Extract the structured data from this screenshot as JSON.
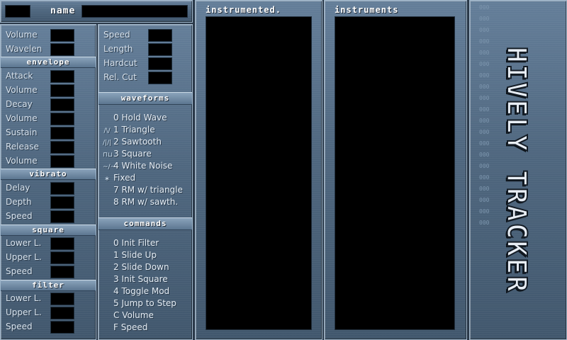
{
  "top": {
    "name_label": "name",
    "name_value": "",
    "index_value": ""
  },
  "left": {
    "rows_top": [
      {
        "key": "volume",
        "label": "Volume"
      },
      {
        "key": "wavelen",
        "label": "Wavelen"
      }
    ],
    "envelope": {
      "header": "envelope",
      "rows": [
        {
          "key": "attack",
          "label": "Attack"
        },
        {
          "key": "attack-volume",
          "label": "Volume"
        },
        {
          "key": "decay",
          "label": "Decay"
        },
        {
          "key": "decay-volume",
          "label": "Volume"
        },
        {
          "key": "sustain",
          "label": "Sustain"
        },
        {
          "key": "release",
          "label": "Release"
        },
        {
          "key": "release-volume",
          "label": "Volume"
        }
      ]
    },
    "vibrato": {
      "header": "vibrato",
      "rows": [
        {
          "key": "delay",
          "label": "Delay"
        },
        {
          "key": "depth",
          "label": "Depth"
        },
        {
          "key": "speed",
          "label": "Speed"
        }
      ]
    },
    "square": {
      "header": "square",
      "rows": [
        {
          "key": "lower",
          "label": "Lower L."
        },
        {
          "key": "upper",
          "label": "Upper L."
        },
        {
          "key": "speed",
          "label": "Speed"
        }
      ]
    },
    "filter": {
      "header": "filter",
      "rows": [
        {
          "key": "lower",
          "label": "Lower L."
        },
        {
          "key": "upper",
          "label": "Upper L."
        },
        {
          "key": "speed",
          "label": "Speed"
        }
      ]
    }
  },
  "mid": {
    "rows": [
      {
        "key": "speed",
        "label": "Speed"
      },
      {
        "key": "length",
        "label": "Length"
      },
      {
        "key": "hardcut",
        "label": "Hardcut"
      },
      {
        "key": "relcut",
        "label": "Rel. Cut"
      }
    ],
    "waveforms": {
      "header": "waveforms",
      "items": [
        {
          "icon": "",
          "text": "0 Hold Wave"
        },
        {
          "icon": "/\\/",
          "text": "1 Triangle"
        },
        {
          "icon": "/|/|",
          "text": "2 Sawtooth"
        },
        {
          "icon": "⊓⊔",
          "text": "3 Square"
        },
        {
          "icon": "~/~",
          "text": "4 White Noise"
        },
        {
          "icon": "∗",
          "text": "Fixed"
        },
        {
          "icon": "",
          "text": "7 RM w/ triangle"
        },
        {
          "icon": "",
          "text": "8 RM w/ sawth."
        }
      ]
    },
    "commands": {
      "header": "commands",
      "items": [
        "0 Init Filter",
        "1 Slide Up",
        "2 Slide Down",
        "3 Init Square",
        "4 Toggle Mod",
        "5 Jump to Step",
        "C Volume",
        "F Speed"
      ]
    }
  },
  "instrument_ed": {
    "title": "instrumented."
  },
  "instruments": {
    "title": "instruments"
  },
  "side": {
    "logo_text": "HIVELY TRACKER"
  }
}
